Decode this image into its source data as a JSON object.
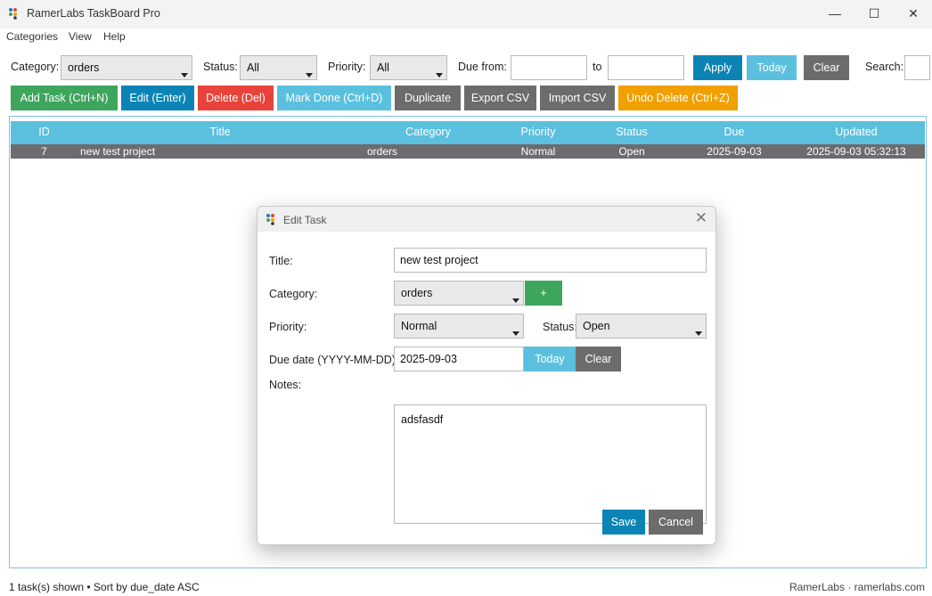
{
  "window": {
    "title": "RamerLabs TaskBoard Pro",
    "minimize": "—",
    "maximize": "☐",
    "close": "✕"
  },
  "menu": [
    "Categories",
    "View",
    "Help"
  ],
  "filters": {
    "category_label": "Category:",
    "category_value": "orders",
    "status_label": "Status:",
    "status_value": "All",
    "priority_label": "Priority:",
    "priority_value": "All",
    "due_from_label": "Due from:",
    "due_from_value": "",
    "to_label": "to",
    "to_value": "",
    "apply": "Apply",
    "today": "Today",
    "clear": "Clear",
    "search_label": "Search:",
    "search_value": ""
  },
  "actions": {
    "add_task": "Add Task (Ctrl+N)",
    "edit": "Edit (Enter)",
    "delete": "Delete (Del)",
    "mark_done": "Mark Done (Ctrl+D)",
    "duplicate": "Duplicate",
    "export_csv": "Export CSV",
    "import_csv": "Import CSV",
    "undo_delete": "Undo Delete (Ctrl+Z)"
  },
  "table": {
    "columns": [
      "ID",
      "Title",
      "Category",
      "Priority",
      "Status",
      "Due",
      "Updated"
    ],
    "rows": [
      {
        "id": "7",
        "title": "new test project",
        "category": "orders",
        "priority": "Normal",
        "status": "Open",
        "due": "2025-09-03",
        "updated": "2025-09-03 05:32:13"
      }
    ]
  },
  "statusbar": {
    "left": "1 task(s) shown • Sort by due_date ASC",
    "right": "RamerLabs · ramerlabs.com"
  },
  "dialog": {
    "title": "Edit Task",
    "close": "✕",
    "title_label": "Title:",
    "title_value": "new test project",
    "category_label": "Category:",
    "category_value": "orders",
    "add_category": "+",
    "priority_label": "Priority:",
    "priority_value": "Normal",
    "status_label": "Status:",
    "status_value": "Open",
    "due_label": "Due date (YYYY-MM-DD):",
    "due_value": "2025-09-03",
    "today": "Today",
    "clear": "Clear",
    "notes_label": "Notes:",
    "notes_value": "adsfasdf",
    "save": "Save",
    "cancel": "Cancel"
  },
  "colors": {
    "green": "#3ea55d",
    "blue": "#0b84b5",
    "red": "#e8433a",
    "light_blue": "#5bc0de",
    "gray": "#6c6c6c",
    "orange": "#f0a000"
  }
}
